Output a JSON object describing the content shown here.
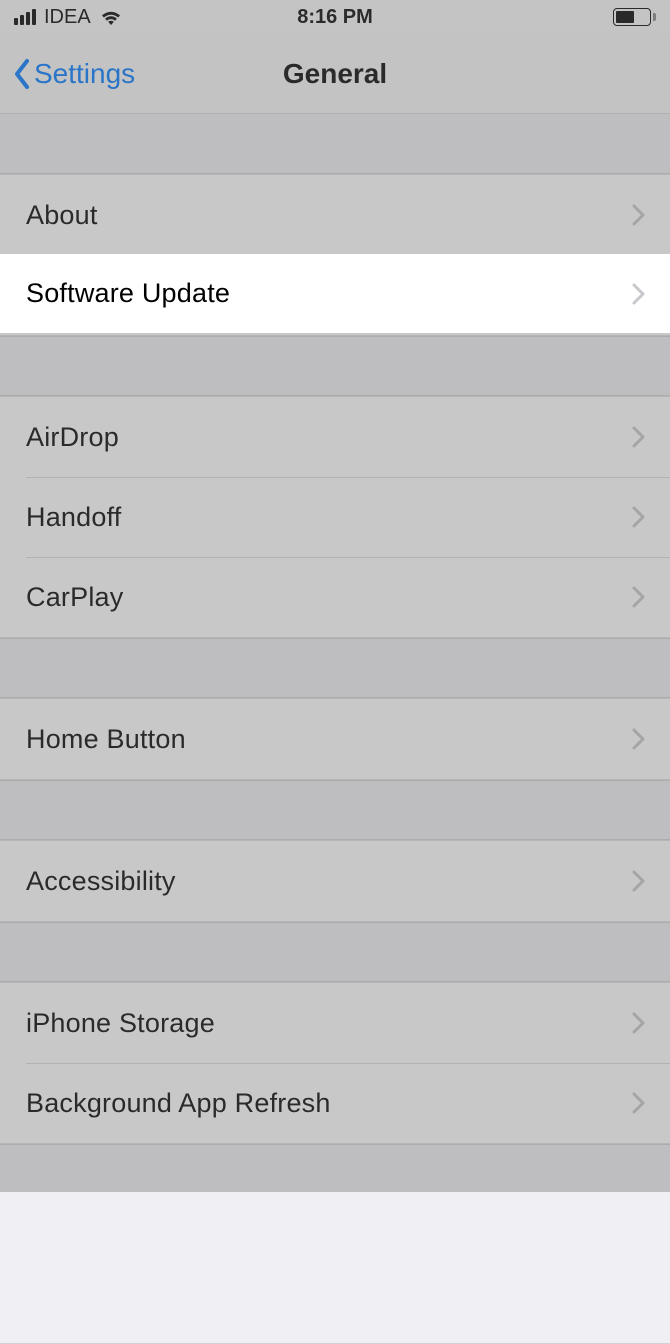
{
  "status": {
    "carrier": "IDEA",
    "time": "8:16 PM"
  },
  "nav": {
    "back": "Settings",
    "title": "General"
  },
  "rows": {
    "about": "About",
    "software_update": "Software Update",
    "airdrop": "AirDrop",
    "handoff": "Handoff",
    "carplay": "CarPlay",
    "home_button": "Home Button",
    "accessibility": "Accessibility",
    "iphone_storage": "iPhone Storage",
    "background_app_refresh": "Background App Refresh"
  }
}
